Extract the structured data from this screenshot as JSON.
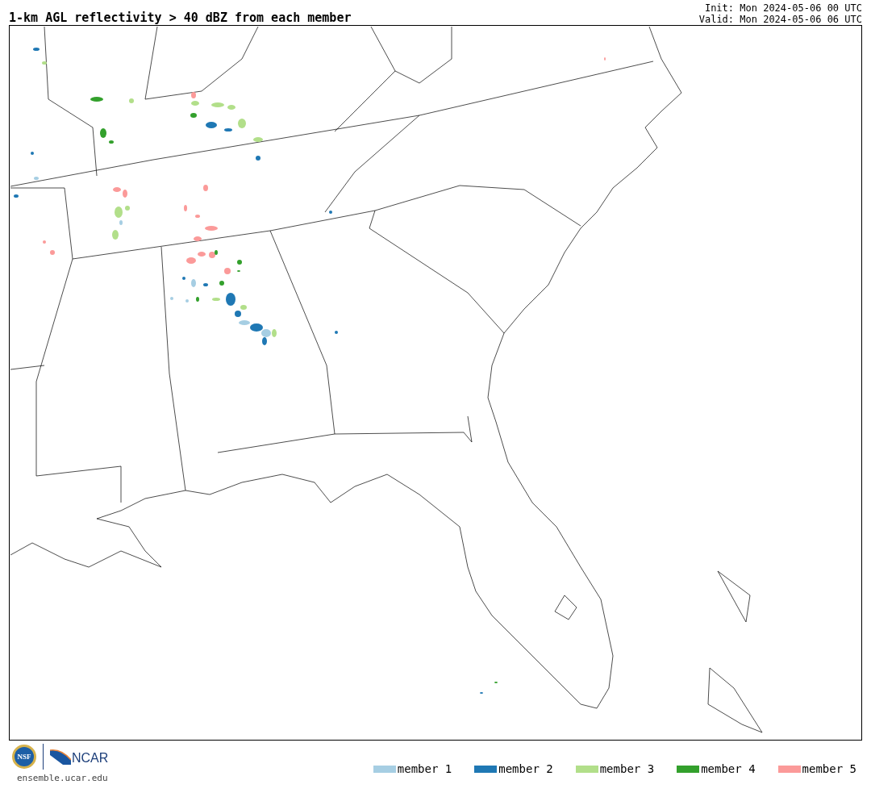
{
  "title": "1-km AGL reflectivity > 40 dBZ from each member",
  "init": "Init: Mon 2024-05-06 00 UTC",
  "valid": "Valid: Mon 2024-05-06 06 UTC",
  "logos": {
    "seal": "NSF",
    "wordmark": "NCAR"
  },
  "site": "ensemble.ucar.edu",
  "legend": [
    {
      "label": "member 1",
      "color": "#a6cee3"
    },
    {
      "label": "member 2",
      "color": "#1f78b4"
    },
    {
      "label": "member 3",
      "color": "#b2df8a"
    },
    {
      "label": "member 4",
      "color": "#33a02c"
    },
    {
      "label": "member 5",
      "color": "#fb9a99"
    }
  ]
}
